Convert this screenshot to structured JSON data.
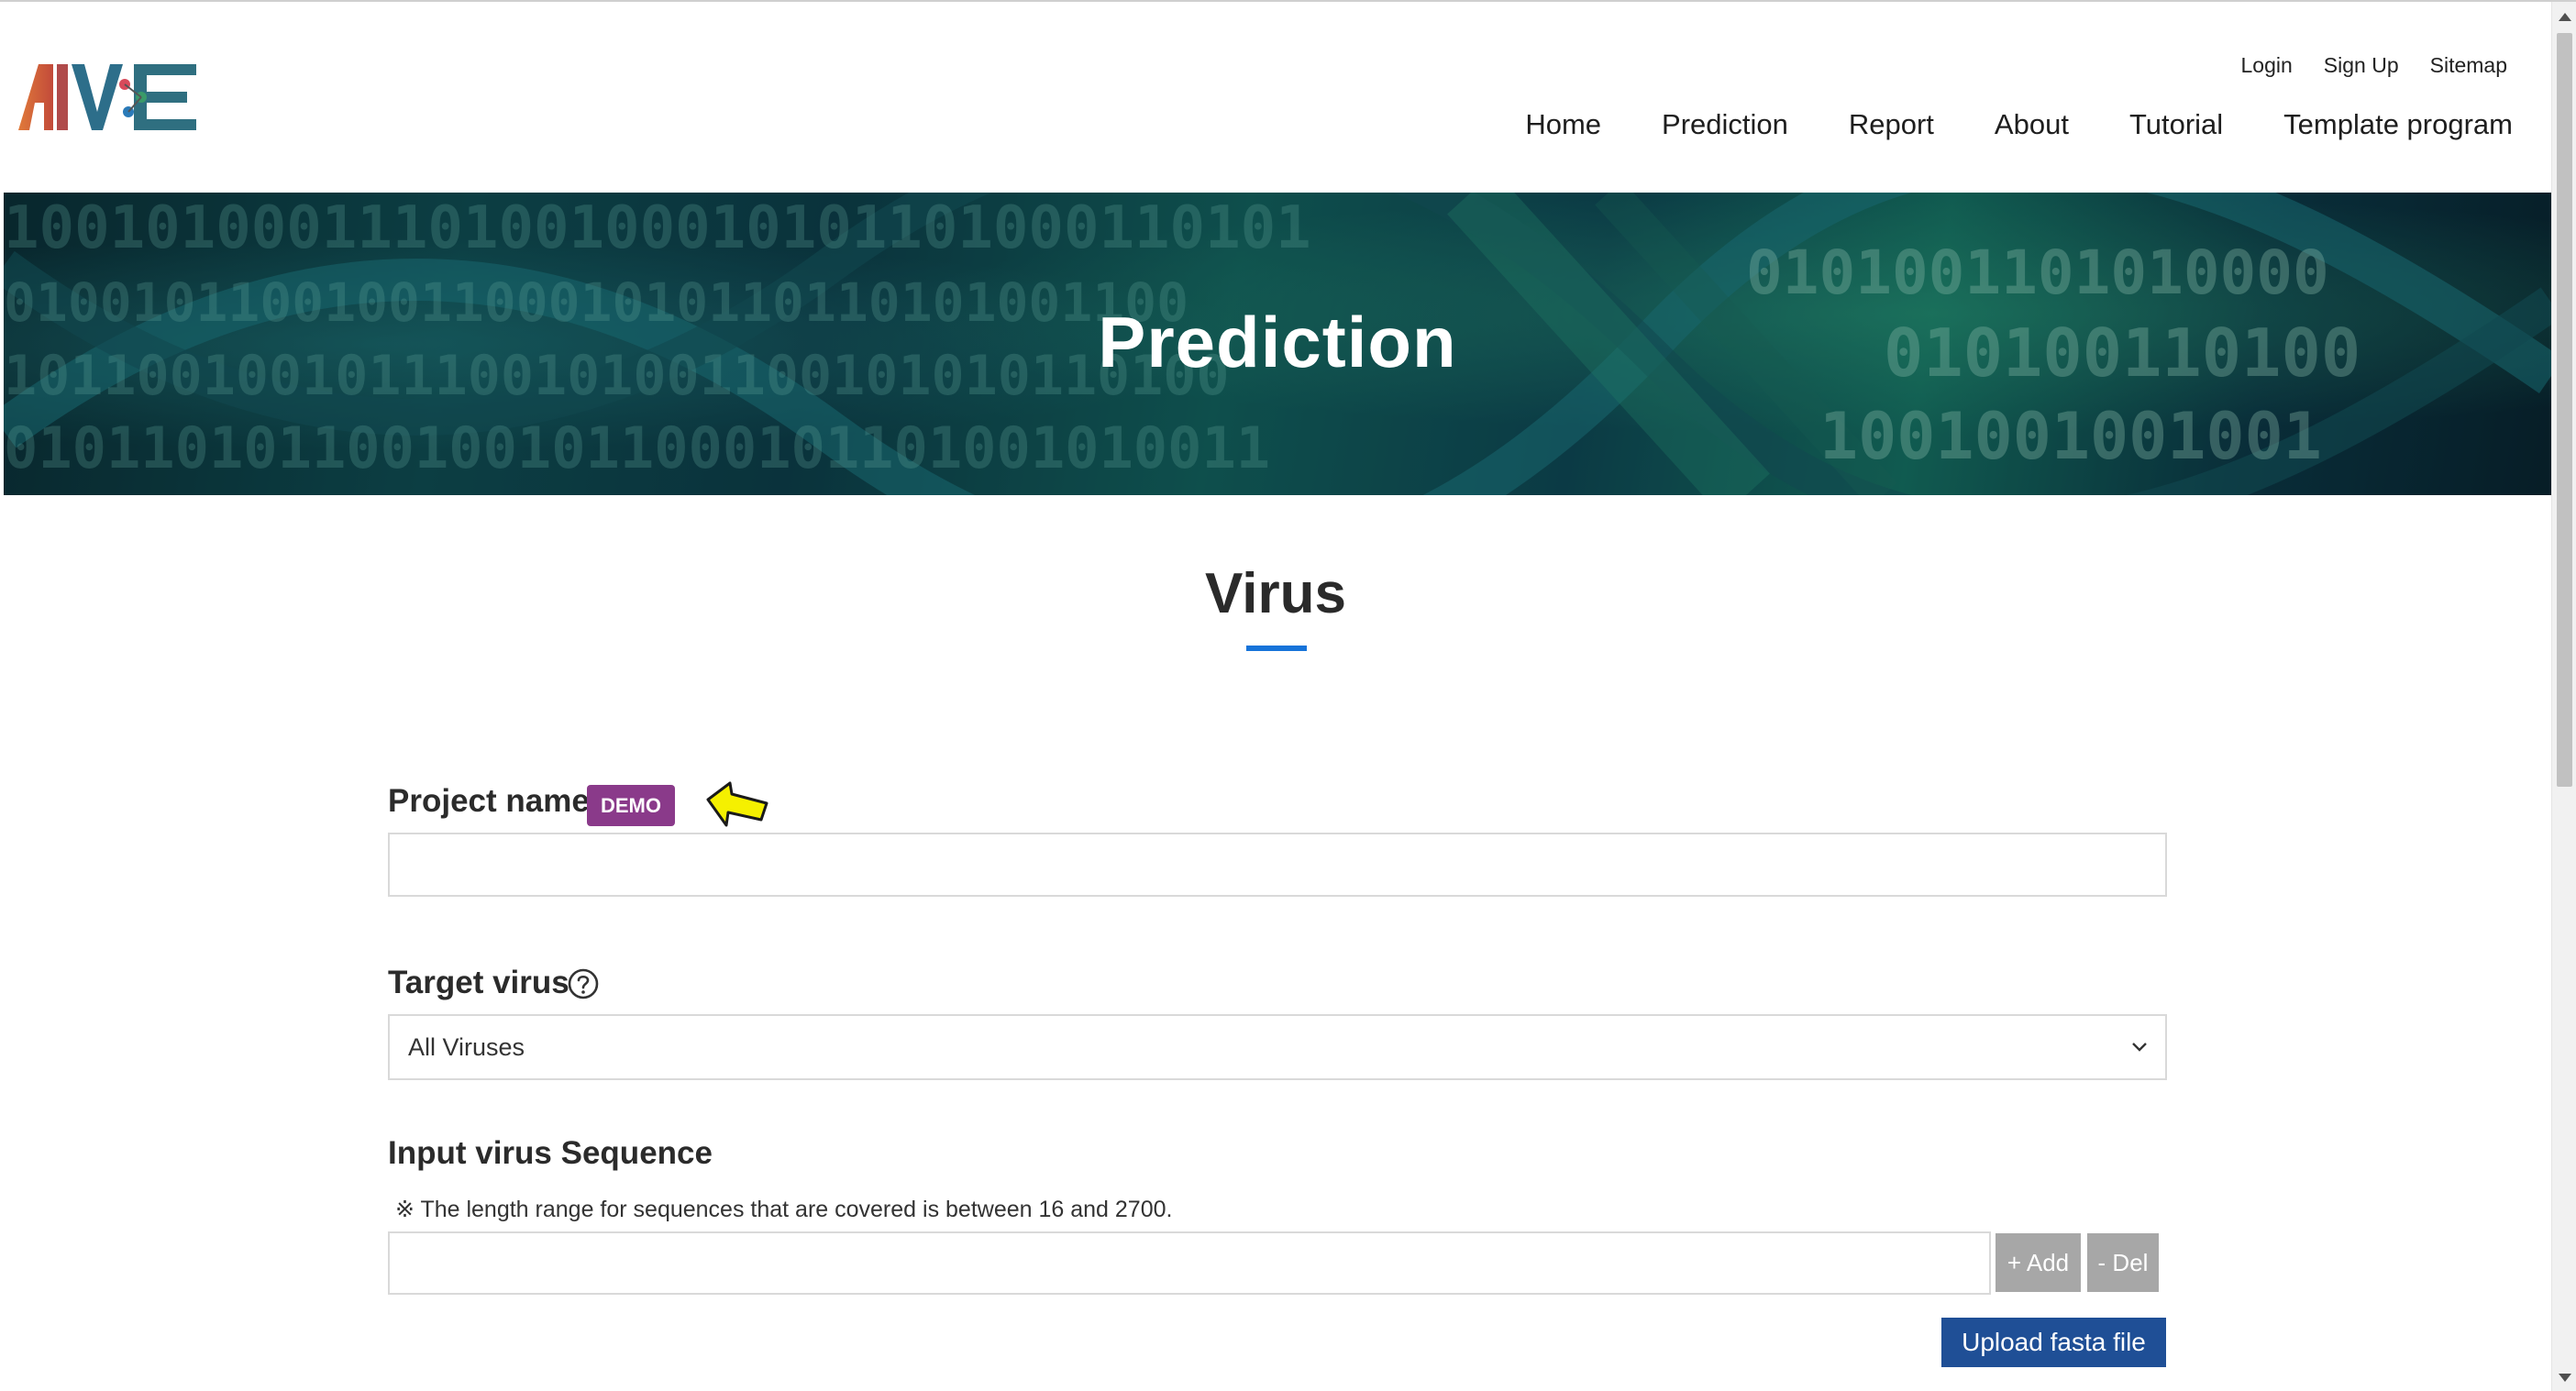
{
  "header": {
    "logo_text": "AIVE",
    "util_nav": [
      "Login",
      "Sign Up",
      "Sitemap"
    ],
    "main_nav": [
      "Home",
      "Prediction",
      "Report",
      "About",
      "Tutorial",
      "Template program"
    ]
  },
  "banner": {
    "title": "Prediction"
  },
  "section": {
    "title": "Virus"
  },
  "form": {
    "project_name_label": "Project name",
    "demo_badge": "DEMO",
    "project_name_value": "",
    "target_virus_label": "Target virus",
    "target_virus_selected": "All Viruses",
    "sequence_label": "Input virus Sequence",
    "sequence_note": "※ The length range for sequences that are covered is between 16 and 2700.",
    "sequence_value": "",
    "add_button": "+ Add",
    "del_button": "- Del",
    "upload_button": "Upload fasta file"
  },
  "colors": {
    "accent_blue": "#1673d9",
    "demo_badge": "#8a3a8a",
    "upload_button": "#1f4f96",
    "gray_button": "#a7a7a7",
    "arrow_fill": "#f5f000"
  },
  "icons": {
    "help": "question-circle-icon",
    "select": "chevron-down-icon",
    "pointer": "left-arrow-icon"
  }
}
